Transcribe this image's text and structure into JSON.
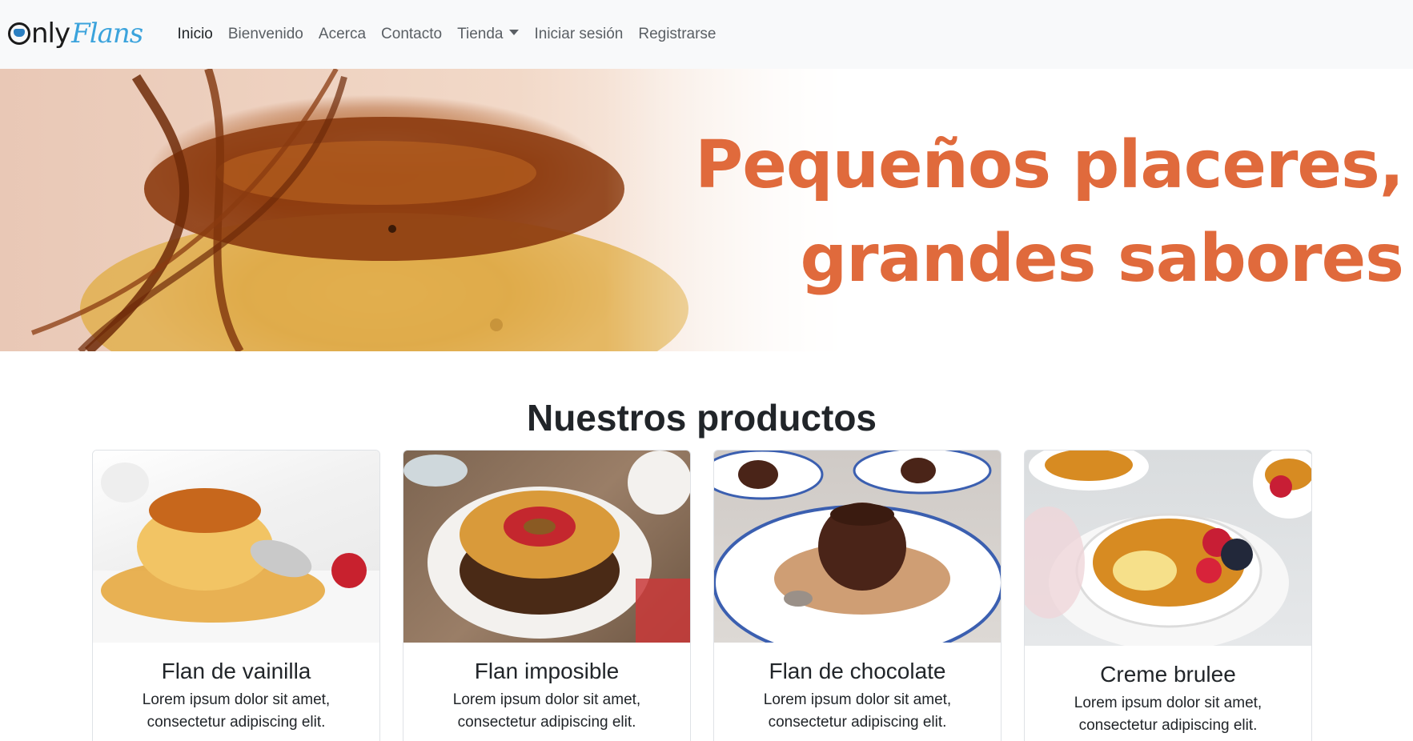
{
  "brand": {
    "only": "Only",
    "flans": "Flans"
  },
  "nav": {
    "items": [
      {
        "label": "Inicio"
      },
      {
        "label": "Bienvenido"
      },
      {
        "label": "Acerca"
      },
      {
        "label": "Contacto"
      },
      {
        "label": "Tienda"
      },
      {
        "label": "Iniciar sesión"
      },
      {
        "label": "Registrarse"
      }
    ]
  },
  "hero": {
    "line1": "Pequeños placeres,",
    "line2": "grandes sabores"
  },
  "products": {
    "title": "Nuestros productos",
    "cards": [
      {
        "name": "Flan de vainilla",
        "text": "Lorem ipsum dolor sit amet, consectetur adipiscing elit."
      },
      {
        "name": "Flan imposible",
        "text": "Lorem ipsum dolor sit amet, consectetur adipiscing elit."
      },
      {
        "name": "Flan de chocolate",
        "text": "Lorem ipsum dolor sit amet, consectetur adipiscing elit."
      },
      {
        "name": "Creme brulee",
        "text": "Lorem ipsum dolor sit amet, consectetur adipiscing elit."
      }
    ]
  },
  "colors": {
    "accent": "#e06a3c",
    "navbar_bg": "#f8f9fa",
    "brand_blue": "#3ba3dc"
  }
}
